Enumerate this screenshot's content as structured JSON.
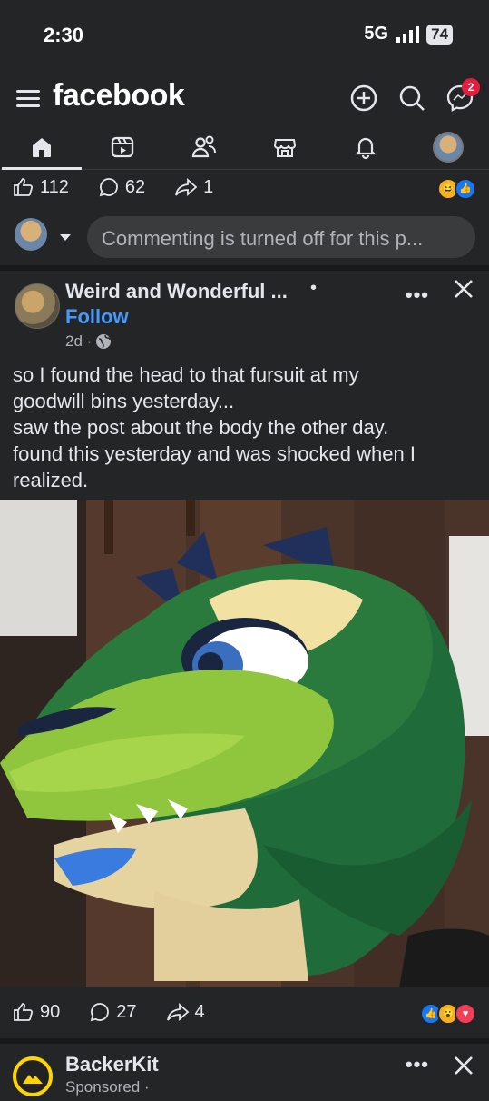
{
  "status": {
    "time": "2:30",
    "network": "5G",
    "battery": "74"
  },
  "appbar": {
    "logo": "facebook",
    "messenger_badge": "2"
  },
  "tabs": [
    {
      "name": "home",
      "icon": "home-icon",
      "active": true
    },
    {
      "name": "video",
      "icon": "video-icon"
    },
    {
      "name": "friends",
      "icon": "friends-icon"
    },
    {
      "name": "marketplace",
      "icon": "marketplace-icon"
    },
    {
      "name": "notifications",
      "icon": "bell-icon"
    },
    {
      "name": "profile",
      "icon": "avatar"
    }
  ],
  "prev_post": {
    "likes": "112",
    "comments": "62",
    "shares": "1"
  },
  "comment_bar": {
    "placeholder": "Commenting is turned off for this p..."
  },
  "post": {
    "page_name": "Weird and Wonderful ...",
    "follow": "Follow",
    "time": "2d ·",
    "text_lines": [
      "so I found the head to that fursuit at my",
      "goodwill bins yesterday...",
      "saw the post about the body the other day.",
      "found this yesterday and was shocked when I",
      "realized."
    ],
    "likes": "90",
    "comments": "27",
    "shares": "4"
  },
  "sponsored": {
    "name": "BackerKit",
    "label": "Sponsored ·"
  },
  "colors": {
    "background": "#242526",
    "link_blue": "#4599ff",
    "text": "#e4e6eb",
    "muted": "#b0b3b8"
  }
}
